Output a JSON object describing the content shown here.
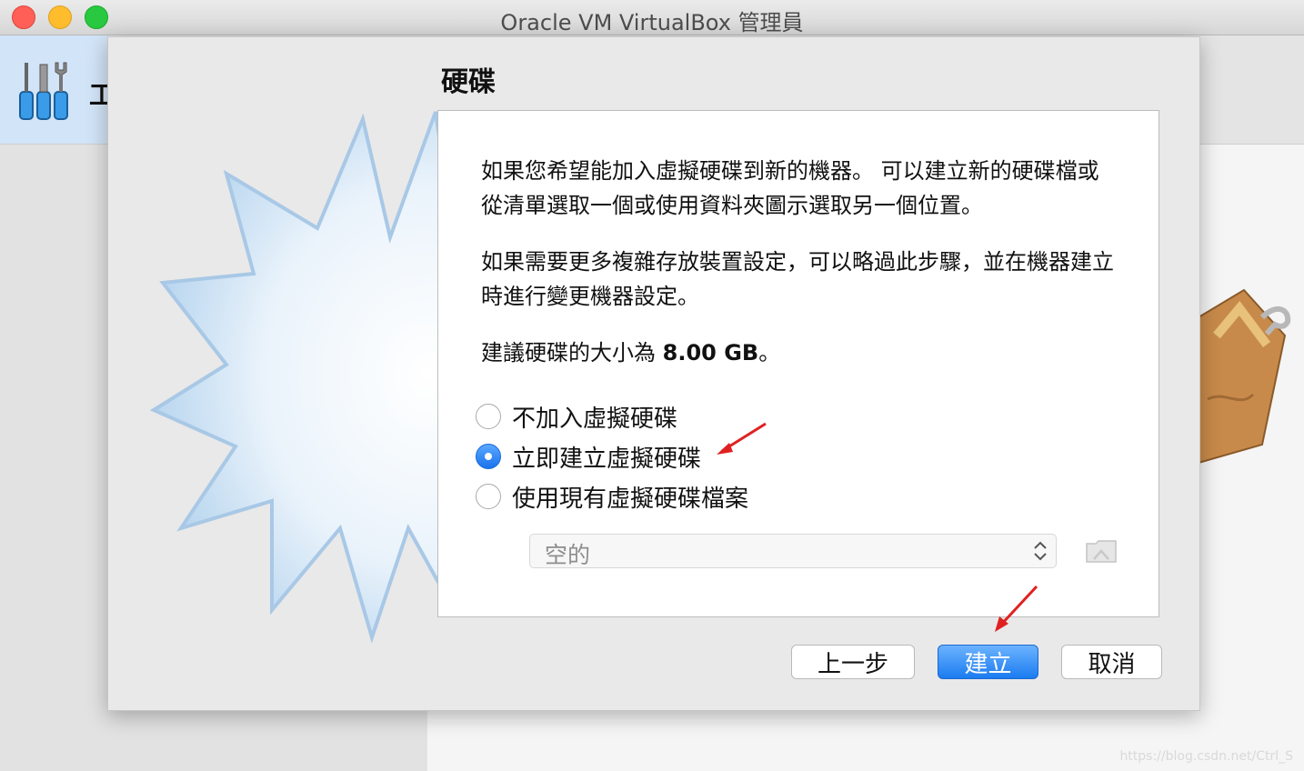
{
  "window": {
    "title": "Oracle VM VirtualBox 管理員",
    "traffic_lights": [
      "#ff5f57",
      "#ffbd2e",
      "#28c940"
    ]
  },
  "toolbar": {
    "tools_label": "工"
  },
  "dialog": {
    "title": "硬碟",
    "paragraphs": [
      "如果您希望能加入虛擬硬碟到新的機器。 可以建立新的硬碟檔或從清單選取一個或使用資料夾圖示選取另一個位置。",
      "如果需要更多複雜存放裝置設定，可以略過此步驟，並在機器建立時進行變更機器設定。"
    ],
    "recommendation": {
      "prefix": "建議硬碟的大小為 ",
      "size": "8.00 GB",
      "suffix": "。"
    },
    "options": [
      {
        "label": "不加入虛擬硬碟",
        "selected": false
      },
      {
        "label": "立即建立虛擬硬碟",
        "selected": true
      },
      {
        "label": "使用現有虛擬硬碟檔案",
        "selected": false
      }
    ],
    "file_select": {
      "value": "空的"
    },
    "buttons": {
      "back": "上一步",
      "create": "建立",
      "cancel": "取消"
    }
  },
  "accent_color": "#1b7cf0",
  "annotation_color": "#e02020",
  "watermark": "https://blog.csdn.net/Ctrl_S"
}
